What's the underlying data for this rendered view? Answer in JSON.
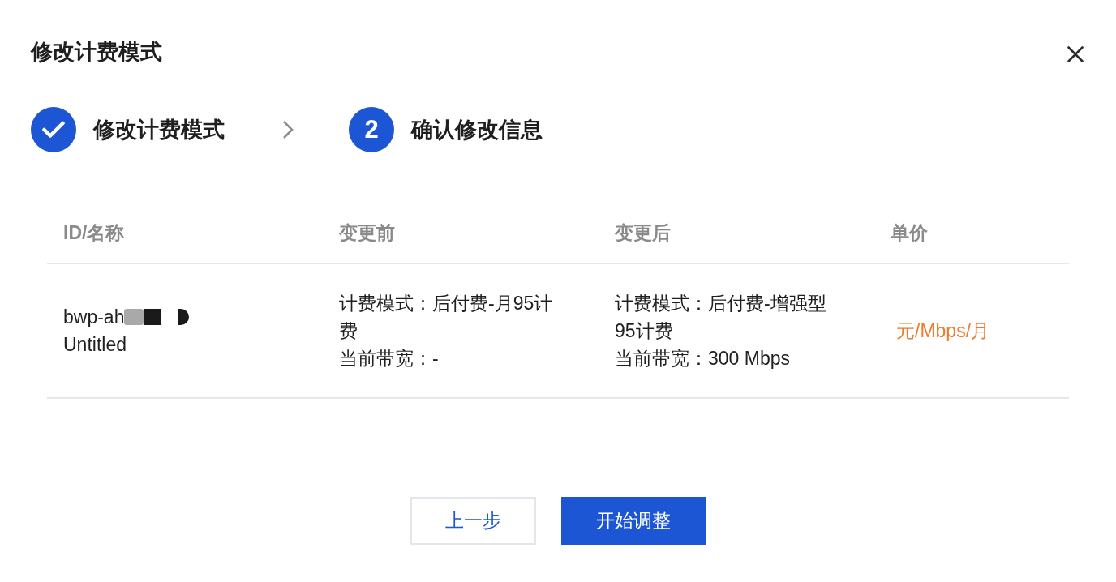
{
  "dialog": {
    "title": "修改计费模式"
  },
  "steps": [
    {
      "label": "修改计费模式",
      "completed": true
    },
    {
      "number": "2",
      "label": "确认修改信息",
      "completed": false
    }
  ],
  "table": {
    "columns": [
      "ID/名称",
      "变更前",
      "变更后",
      "单价"
    ],
    "rows": [
      {
        "id": "bwp-ah",
        "id_redacted": true,
        "name": "Untitled",
        "before": [
          "计费模式：后付费-月95计费",
          "当前带宽：-"
        ],
        "after": [
          "计费模式：后付费-增强型95计费",
          "当前带宽：300 Mbps"
        ],
        "unit_price": "元/Mbps/月"
      }
    ]
  },
  "buttons": [
    {
      "label": "上一步",
      "kind": "secondary"
    },
    {
      "label": "开始调整",
      "kind": "primary"
    }
  ]
}
